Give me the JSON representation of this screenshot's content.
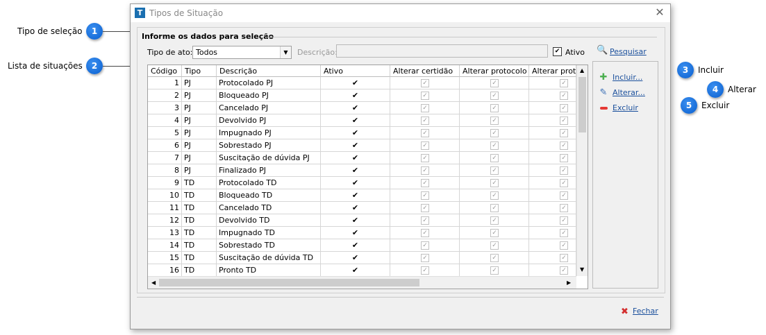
{
  "window": {
    "title": "Tipos de Situação",
    "app_icon_letter": "T"
  },
  "callouts": [
    {
      "number": "1",
      "label": "Tipo de seleção"
    },
    {
      "number": "2",
      "label": "Lista de situações"
    },
    {
      "number": "3",
      "label": "Incluir"
    },
    {
      "number": "4",
      "label": "Alterar"
    },
    {
      "number": "5",
      "label": "Excluir"
    }
  ],
  "filter": {
    "group_title": "Informe os dados para seleção",
    "tipo_label": "Tipo de ato:",
    "tipo_value": "Todos",
    "descricao_label": "Descrição:",
    "descricao_value": "",
    "ativo_label": "Ativo",
    "ativo_checked": true,
    "search_label": "Pesquisar"
  },
  "grid": {
    "columns": [
      "Código",
      "Tipo",
      "Descrição",
      "Ativo",
      "Alterar certidão",
      "Alterar protocolo ...",
      "Alterar protoc"
    ],
    "rows": [
      {
        "codigo": "1",
        "tipo": "PJ",
        "descricao": "Protocolado PJ"
      },
      {
        "codigo": "2",
        "tipo": "PJ",
        "descricao": "Bloqueado PJ"
      },
      {
        "codigo": "3",
        "tipo": "PJ",
        "descricao": "Cancelado PJ"
      },
      {
        "codigo": "4",
        "tipo": "PJ",
        "descricao": "Devolvido PJ"
      },
      {
        "codigo": "5",
        "tipo": "PJ",
        "descricao": "Impugnado PJ"
      },
      {
        "codigo": "6",
        "tipo": "PJ",
        "descricao": "Sobrestado PJ"
      },
      {
        "codigo": "7",
        "tipo": "PJ",
        "descricao": "Suscitação de dúvida PJ"
      },
      {
        "codigo": "8",
        "tipo": "PJ",
        "descricao": "Finalizado PJ"
      },
      {
        "codigo": "9",
        "tipo": "TD",
        "descricao": "Protocolado TD"
      },
      {
        "codigo": "10",
        "tipo": "TD",
        "descricao": "Bloqueado TD"
      },
      {
        "codigo": "11",
        "tipo": "TD",
        "descricao": "Cancelado TD"
      },
      {
        "codigo": "12",
        "tipo": "TD",
        "descricao": "Devolvido TD"
      },
      {
        "codigo": "13",
        "tipo": "TD",
        "descricao": "Impugnado TD"
      },
      {
        "codigo": "14",
        "tipo": "TD",
        "descricao": "Sobrestado TD"
      },
      {
        "codigo": "15",
        "tipo": "TD",
        "descricao": "Suscitação de dúvida TD"
      },
      {
        "codigo": "16",
        "tipo": "TD",
        "descricao": "Pronto TD"
      }
    ]
  },
  "actions": {
    "incluir": "Incluir...",
    "alterar": "Alterar...",
    "excluir": "Excluir"
  },
  "footer": {
    "fechar": "Fechar"
  },
  "colors": {
    "accent": "#0a5fcf",
    "link": "#1a4f9c",
    "add": "#4caf50",
    "delete": "#e53935",
    "close": "#d32f2f"
  }
}
